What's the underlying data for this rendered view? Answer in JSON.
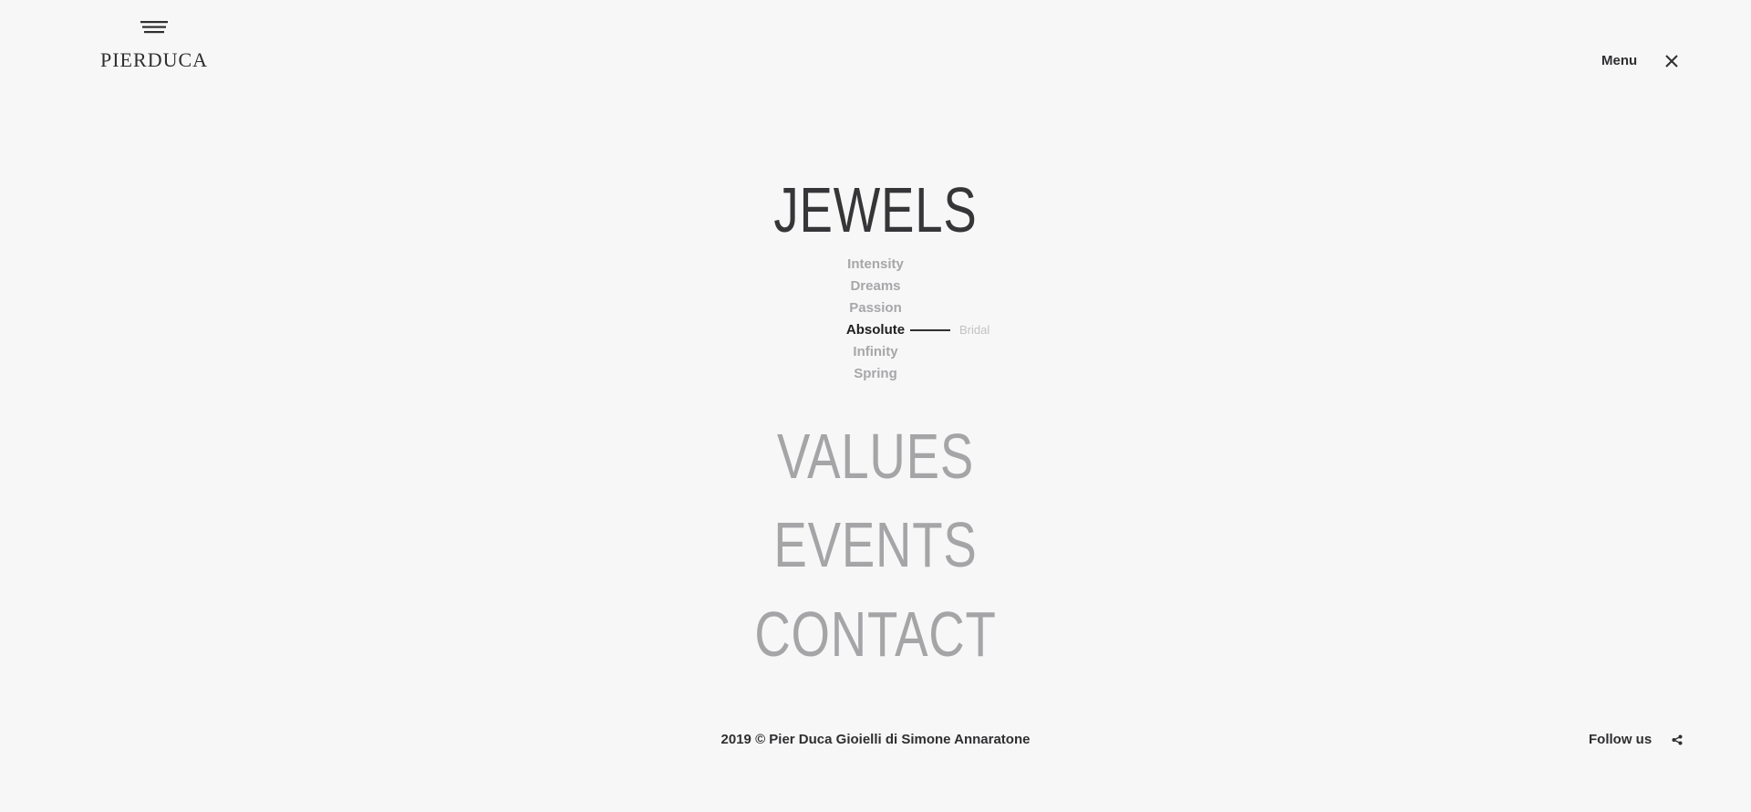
{
  "brand": {
    "logo_prefix": "PIER",
    "logo_suffix": "DUCA",
    "logo_icon": "stacked-lines-icon"
  },
  "header": {
    "menu_label": "Menu",
    "close_icon": "close-icon"
  },
  "nav": {
    "jewels": {
      "label": "JEWELS",
      "subitems": [
        "Intensity",
        "Dreams",
        "Passion",
        "Absolute",
        "Infinity",
        "Spring"
      ],
      "current_subitem": "Absolute",
      "current_child": "Bridal"
    },
    "values": {
      "label": "VALUES"
    },
    "events": {
      "label": "EVENTS"
    },
    "contact": {
      "label": "CONTACT"
    }
  },
  "footer": {
    "copyright": "2019 © Pier Duca Gioielli di Simone Annaratone",
    "follow_label": "Follow us",
    "share_icon": "share-icon"
  },
  "colors": {
    "background": "#f7f7f7",
    "text_dark": "#363639",
    "text_muted": "#a5a5a8",
    "text_faint": "#c2c2c4"
  }
}
